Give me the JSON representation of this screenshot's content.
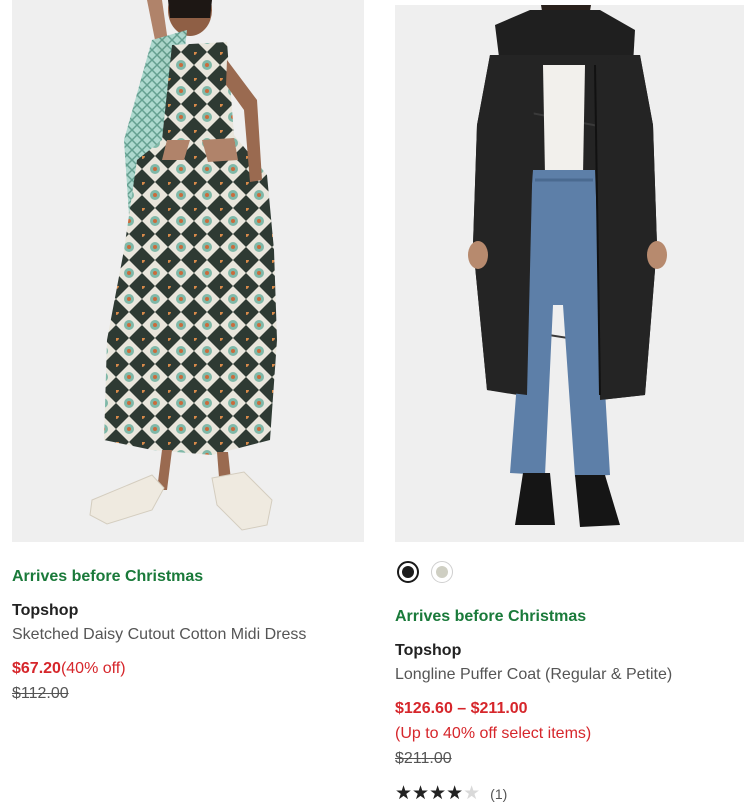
{
  "products": [
    {
      "arrival": "Arrives before Christmas",
      "brand": "Topshop",
      "name": "Sketched Daisy Cutout Cotton Midi Dress",
      "price": "$67.20",
      "discount": "(40% off)",
      "original_price": "$112.00"
    },
    {
      "swatches": [
        {
          "color": "#1c1c1c",
          "selected": true
        },
        {
          "color": "#cfcfc3",
          "selected": false
        }
      ],
      "arrival": "Arrives before Christmas",
      "brand": "Topshop",
      "name": "Longline Puffer Coat (Regular & Petite)",
      "price": "$126.60 – $211.00",
      "discount": "(Up to 40% off select items)",
      "original_price": "$211.00",
      "rating": {
        "stars": "★★★★★",
        "value": 4,
        "count": "(1)"
      }
    }
  ],
  "colors": {
    "arrival": "#1a7a3a",
    "sale": "#d6262b"
  }
}
